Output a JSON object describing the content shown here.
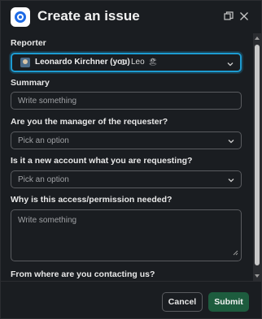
{
  "header": {
    "title": "Create an issue",
    "app_icon": "jira-service-desk-icon",
    "restore_icon": "restore-window-icon",
    "close_icon": "close-icon"
  },
  "form": {
    "reporter": {
      "label": "Reporter",
      "name": "Leonardo Kirchner (you)",
      "alias": "Leo",
      "emoji": "🏖"
    },
    "summary": {
      "label": "Summary",
      "placeholder": "Write something"
    },
    "manager": {
      "label": "Are you the manager of the requester?",
      "placeholder": "Pick an option"
    },
    "new_account": {
      "label": "Is it a new account what you are requesting?",
      "placeholder": "Pick an option"
    },
    "why": {
      "label": "Why is this access/permission needed?",
      "placeholder": "Write something"
    },
    "contact_from": {
      "label": "From where are you contacting us?"
    }
  },
  "footer": {
    "cancel_label": "Cancel",
    "submit_label": "Submit"
  },
  "colors": {
    "focus_border": "#1d9bd1",
    "submit_bg": "#1d5c3e",
    "background": "#1a1d21"
  }
}
